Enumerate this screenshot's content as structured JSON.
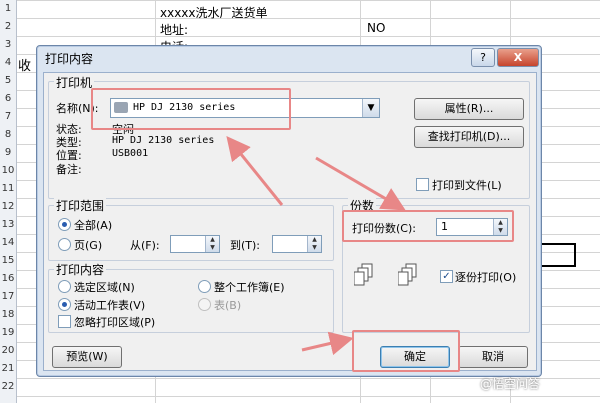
{
  "spreadsheet": {
    "row_numbers": [
      "1",
      "2",
      "3",
      "4",
      "5",
      "6",
      "7",
      "8",
      "9",
      "10",
      "11",
      "12",
      "13",
      "14",
      "15",
      "16",
      "17",
      "18",
      "19",
      "20",
      "21",
      "22"
    ],
    "title_cell": "xxxxx洗水厂送货单",
    "address_label": "地址:",
    "phone_label": "电话:",
    "no_label": "NO",
    "receiver_label": "收"
  },
  "dialog": {
    "title": "打印内容",
    "help_button": "?",
    "close_button": "X",
    "printer_group": {
      "label": "打印机",
      "name_label": "名称(N):",
      "name_value": "HP DJ 2130 series",
      "status_label": "状态:",
      "status_value": "空闲",
      "type_label": "类型:",
      "type_value": "HP DJ 2130 series",
      "location_label": "位置:",
      "location_value": "USB001",
      "comment_label": "备注:",
      "properties_button": "属性(R)...",
      "find_printer_button": "查找打印机(D)...",
      "print_to_file_label": "打印到文件(L)"
    },
    "range_group": {
      "label": "打印范围",
      "all_label": "全部(A)",
      "pages_label": "页(G)",
      "from_label": "从(F):",
      "to_label": "到(T):"
    },
    "what_group": {
      "label": "打印内容",
      "selection_label": "选定区域(N)",
      "workbook_label": "整个工作簿(E)",
      "active_sheet_label": "活动工作表(V)",
      "table_label": "表(B)",
      "ignore_area_label": "忽略打印区域(P)"
    },
    "copies_group": {
      "label": "份数",
      "copies_label": "打印份数(C):",
      "copies_value": "1",
      "collate_label": "逐份打印(O)"
    },
    "preview_button": "预览(W)",
    "ok_button": "确定",
    "cancel_button": "取消"
  },
  "watermark": "@悟空问答",
  "colors": {
    "highlight": "#e88787",
    "dialog_bg": "#dbe5f1",
    "client_bg": "#f0f0f0"
  }
}
